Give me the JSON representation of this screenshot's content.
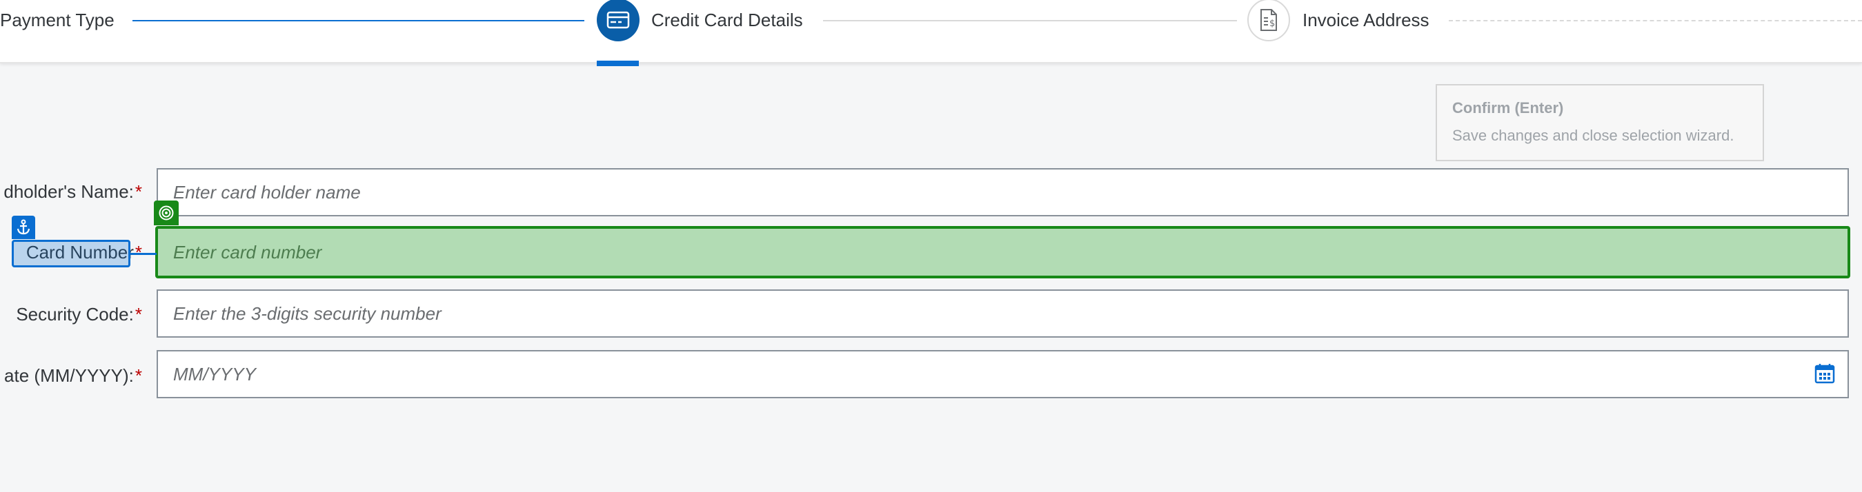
{
  "wizard": {
    "steps": [
      {
        "label": "Payment Type",
        "state": "completed"
      },
      {
        "label": "Credit Card Details",
        "state": "active",
        "icon": "credit-card-icon"
      },
      {
        "label": "Invoice Address",
        "state": "upcoming",
        "icon": "invoice-document-icon"
      }
    ]
  },
  "tooltip": {
    "title": "Confirm (Enter)",
    "description": "Save changes and close selection wizard."
  },
  "form": {
    "required_marker": "*",
    "cardholder": {
      "label": "dholder's Name:",
      "placeholder": "Enter card holder name"
    },
    "card_number": {
      "label": "Card Number",
      "placeholder": "Enter card number"
    },
    "security_code": {
      "label": "Security Code:",
      "placeholder": "Enter the 3-digits security number"
    },
    "expiry": {
      "label": "ate (MM/YYYY):",
      "placeholder": "MM/YYYY",
      "icon": "calendar-icon"
    }
  },
  "overlay": {
    "anchor_icon": "anchor-icon",
    "target_icon": "target-icon"
  },
  "colors": {
    "accent": "#0a6ed1",
    "active_step": "#0a5ea8",
    "highlight_fill": "#b2dcb4",
    "highlight_border": "#188918",
    "required": "#bb0000"
  }
}
